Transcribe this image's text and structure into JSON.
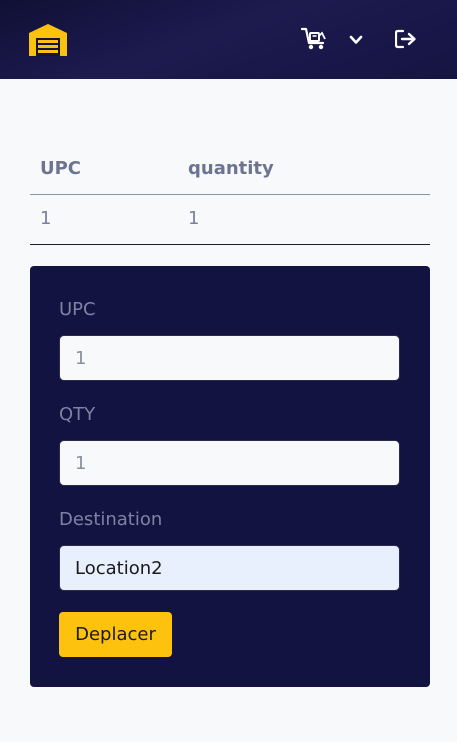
{
  "navbar": {
    "logo_icon": "warehouse-icon",
    "cart_icon": "cart-icon",
    "chevron_icon": "chevron-down-icon",
    "logout_icon": "logout-icon",
    "accent_color": "#fdc20d",
    "background_color": "#15143f"
  },
  "table": {
    "headers": [
      "UPC",
      "quantity"
    ],
    "rows": [
      [
        "1",
        "1"
      ]
    ]
  },
  "form": {
    "upc_label": "UPC",
    "upc_value": "1",
    "qty_label": "QTY",
    "qty_value": "1",
    "destination_label": "Destination",
    "destination_value": "Location2",
    "submit_label": "Deplacer"
  }
}
